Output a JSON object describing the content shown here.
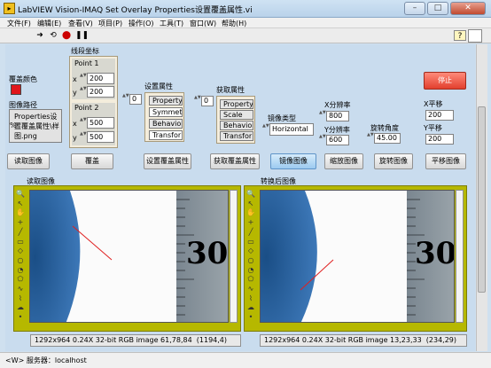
{
  "window": {
    "title": "LabVIEW Vision-IMAQ Set Overlay Properties设置覆盖属性.vi",
    "app_icon": "labview-icon",
    "controls": [
      "minimize",
      "maximize",
      "close"
    ]
  },
  "menu": [
    "文件(F)",
    "编辑(E)",
    "查看(V)",
    "项目(P)",
    "操作(O)",
    "工具(T)",
    "窗口(W)",
    "帮助(H)"
  ],
  "toolbar": {
    "buttons": [
      "run-arrow-icon",
      "run-continuously-icon",
      "abort-icon",
      "pause-icon"
    ],
    "help_icon": "help-icon"
  },
  "controls": {
    "overlay_color_label": "覆盖颜色",
    "overlay_color": "#e0161b",
    "image_path_label": "图像路径",
    "image_path_value": "Properties设置覆盖属性\\样图.png",
    "image_path_prefix": "%",
    "line_coords_label": "线段坐标",
    "point1_label": "Point 1",
    "point1_x": "200",
    "point1_y": "200",
    "point2_label": "Point 2",
    "point2_x": "500",
    "point2_y": "500",
    "set_props_label": "设置属性",
    "set_props_index": "0",
    "set_props_items": [
      "Property",
      "Symmetr",
      "Behavior",
      "Transfor"
    ],
    "get_props_label": "获取属性",
    "get_props_index": "0",
    "get_props_items": [
      "Property",
      "Scale",
      "Behavior",
      "Transfor"
    ],
    "mirror_type_label": "镜像类型",
    "mirror_type_value": "Horizontal",
    "x_res_label": "X分辨率",
    "x_res_value": "800",
    "y_res_label": "Y分辨率",
    "y_res_value": "600",
    "rotate_label": "旋转角度",
    "rotate_value": "45.00",
    "x_shift_label": "X平移",
    "x_shift_value": "200",
    "y_shift_label": "Y平移",
    "y_shift_value": "200",
    "stop_label": "停止",
    "x_axis_letter": "x",
    "y_axis_letter": "y"
  },
  "buttons": {
    "read_image": "读取图像",
    "overlay": "覆盖",
    "set_overlay_props": "设置覆盖属性",
    "get_overlay_props": "获取覆盖属性",
    "mirror_image": "镜像图像",
    "scale_image": "缩放图像",
    "rotate_image": "旋转图像",
    "translate_image": "平移图像"
  },
  "display_left": {
    "label": "读取图像",
    "status": "1292x964 0.24X 32-bit RGB image 61,78,84",
    "coords": "(1194,4)",
    "ruler_number": "30"
  },
  "display_right": {
    "label": "转换后图像",
    "status": "1292x964 0.24X 32-bit RGB image 13,23,33",
    "coords": "(234,29)",
    "ruler_number": "30"
  },
  "image_tools": [
    "zoom-icon",
    "pointer-icon",
    "pan-icon",
    "crosshair-icon",
    "line-icon",
    "rectangle-icon",
    "rotated-rect-icon",
    "oval-icon",
    "annulus-icon",
    "polygon-icon",
    "freehand-icon",
    "broken-line-icon",
    "freehand-region-icon",
    "point-icon"
  ],
  "statusbar": {
    "text": "<W> 服务器：localhost"
  }
}
